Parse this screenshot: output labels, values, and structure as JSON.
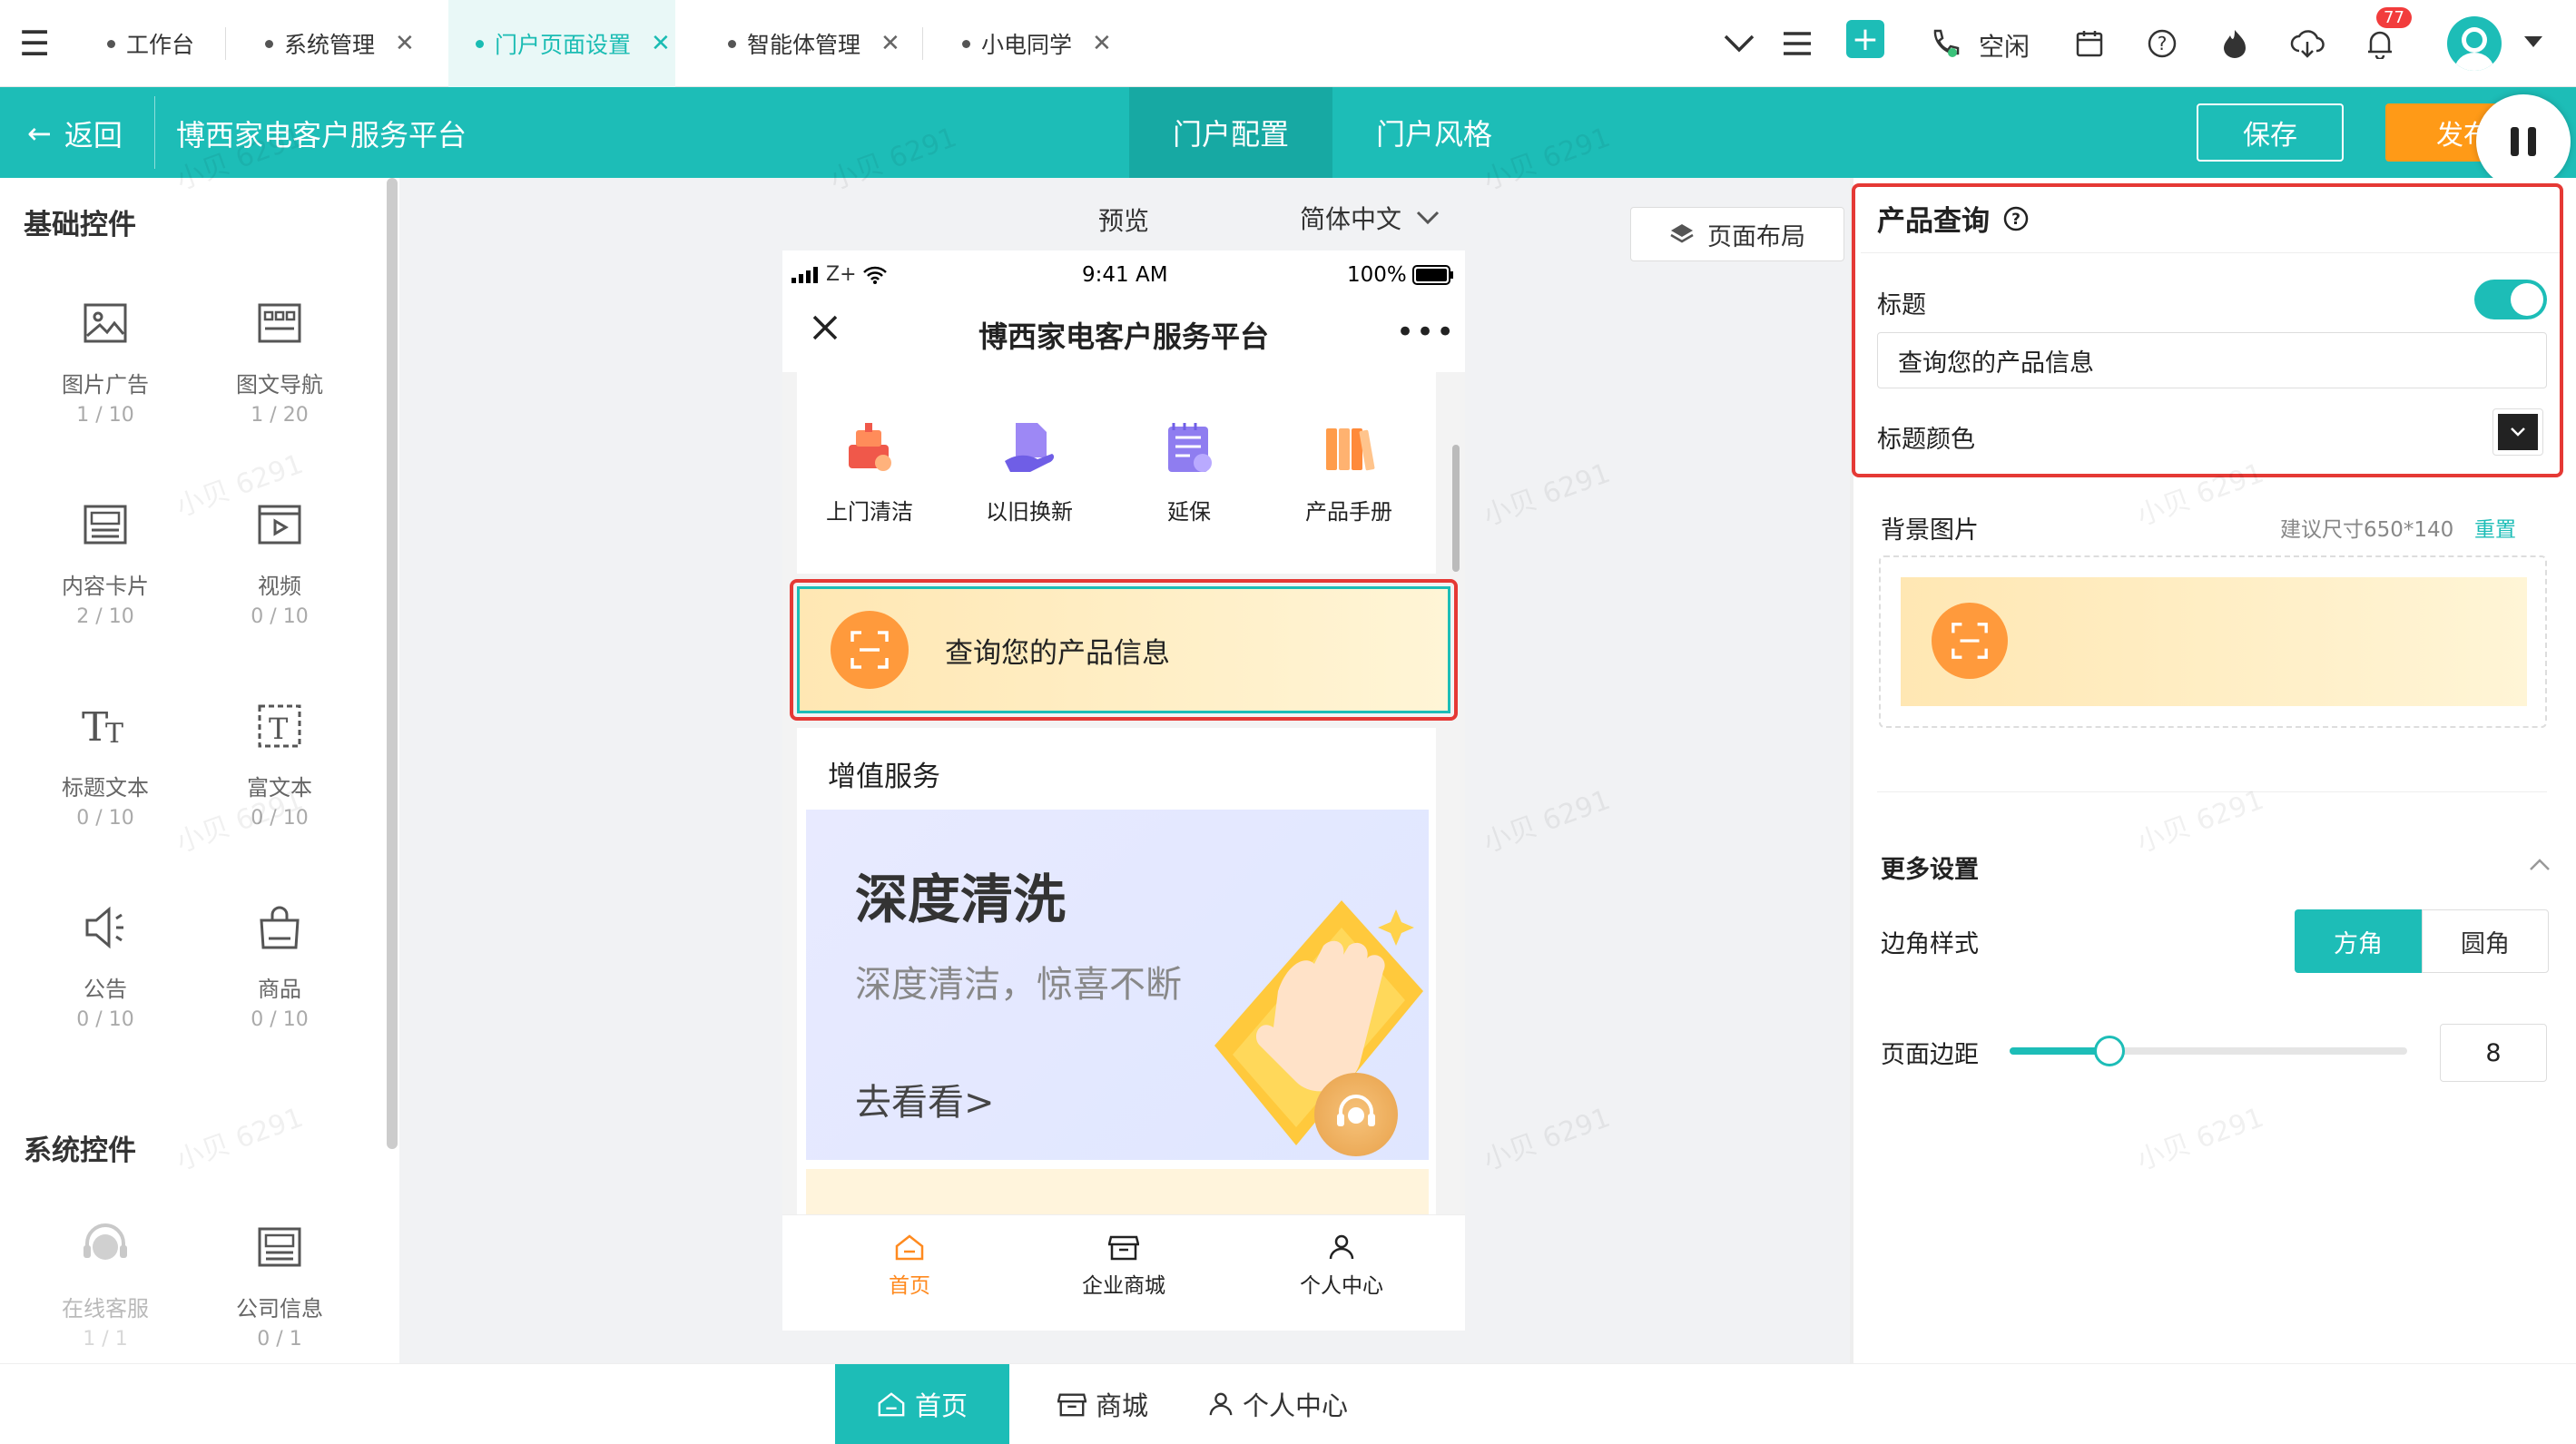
{
  "tabs": [
    {
      "label": "工作台"
    },
    {
      "label": "系统管理"
    },
    {
      "label": "门户页面设置"
    },
    {
      "label": "智能体管理"
    },
    {
      "label": "小电同学"
    }
  ],
  "topbar": {
    "status": "空闲",
    "notif_count": "77"
  },
  "header": {
    "back": "返回",
    "title": "博西家电客户服务平台",
    "tab_config": "门户配置",
    "tab_style": "门户风格",
    "save": "保存",
    "publish": "发布"
  },
  "left": {
    "basic_title": "基础控件",
    "basic": [
      {
        "name": "图片广告",
        "count": "1 / 10"
      },
      {
        "name": "图文导航",
        "count": "1 / 20"
      },
      {
        "name": "内容卡片",
        "count": "2 / 10"
      },
      {
        "name": "视频",
        "count": "0 / 10"
      },
      {
        "name": "标题文本",
        "count": "0 / 10"
      },
      {
        "name": "富文本",
        "count": "0 / 10"
      },
      {
        "name": "公告",
        "count": "0 / 10"
      },
      {
        "name": "商品",
        "count": "0 / 10"
      }
    ],
    "system_title": "系统控件",
    "system": [
      {
        "name": "在线客服",
        "count": "1 / 1"
      },
      {
        "name": "公司信息",
        "count": "0 / 1"
      }
    ]
  },
  "canvas": {
    "preview": "预览",
    "language": "简体中文",
    "layout_btn": "页面布局"
  },
  "phone": {
    "signal": "Z+",
    "time": "9:41 AM",
    "battery": "100%",
    "title": "博西家电客户服务平台",
    "nav": [
      {
        "label": "上门清洁"
      },
      {
        "label": "以旧换新"
      },
      {
        "label": "延保"
      },
      {
        "label": "产品手册"
      }
    ],
    "query_text": "查询您的产品信息",
    "section_title": "增值服务",
    "banner_title": "深度清洗",
    "banner_sub": "深度清洁，惊喜不断",
    "banner_link": "去看看>",
    "tabbar": [
      {
        "label": "首页"
      },
      {
        "label": "企业商城"
      },
      {
        "label": "个人中心"
      }
    ]
  },
  "right": {
    "title": "产品查询",
    "title_label": "标题",
    "title_value": "查询您的产品信息",
    "title_color_label": "标题颜色",
    "title_color": "#222222",
    "bg_label": "背景图片",
    "bg_hint": "建议尺寸650*140",
    "bg_reset": "重置",
    "more": "更多设置",
    "corner_label": "边角样式",
    "corner_square": "方角",
    "corner_round": "圆角",
    "margin_label": "页面边距",
    "margin_value": "8",
    "margin_slider_fraction": 0.25
  },
  "bottom": {
    "tabs": [
      {
        "label": "首页"
      },
      {
        "label": "商城"
      },
      {
        "label": "个人中心"
      }
    ]
  },
  "watermark": "小贝 6291",
  "colors": {
    "accent": "#1dbdb7",
    "highlight": "#e53935",
    "orange": "#ff9a17"
  }
}
